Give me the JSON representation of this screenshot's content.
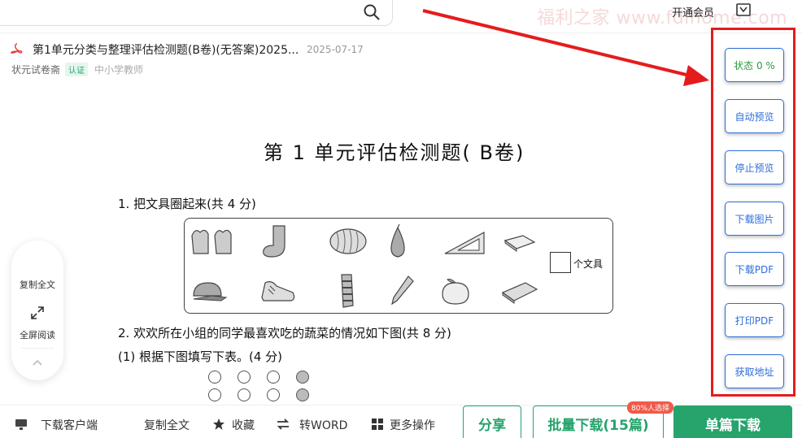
{
  "topbar": {
    "member_label": "开通会员",
    "watermark": "福利之家 www.fdlhome.com"
  },
  "doc": {
    "title": "第1单元分类与整理评估检测题(B卷)(无答案)2025...",
    "date": "2025-07-17",
    "author": "状元试卷斋",
    "verify_badge": "认证",
    "role": "中小学教师"
  },
  "exam": {
    "title": "第 1 单元评估检测题( B卷)",
    "q1": "1. 把文具圈起来(共 4 分)",
    "unit": "个文具",
    "q2": "2. 欢欢所在小组的同学最喜欢吃的蔬菜的情况如下图(共 8 分)",
    "q2_1": "(1) 根据下图填写下表。(4 分)"
  },
  "left_panel": {
    "copy_all": "复制全文",
    "fullscreen": "全屏阅读"
  },
  "side_buttons": [
    {
      "label": "状态 0 %"
    },
    {
      "label": "自动预览"
    },
    {
      "label": "停止预览"
    },
    {
      "label": "下载图片"
    },
    {
      "label": "下载PDF"
    },
    {
      "label": "打印PDF"
    },
    {
      "label": "获取地址"
    }
  ],
  "bottom": {
    "download_client": "下载客户端",
    "copy_all": "复制全文",
    "favorite": "收藏",
    "to_word": "转WORD",
    "more": "更多操作",
    "share": "分享",
    "batch_download": "批量下载(15篇)",
    "batch_badge": "80%人选择",
    "single_download": "单篇下载"
  },
  "colors": {
    "accent_green": "#27a36c",
    "button_blue": "#2d6ed9",
    "frame_red": "#e51c1c"
  }
}
